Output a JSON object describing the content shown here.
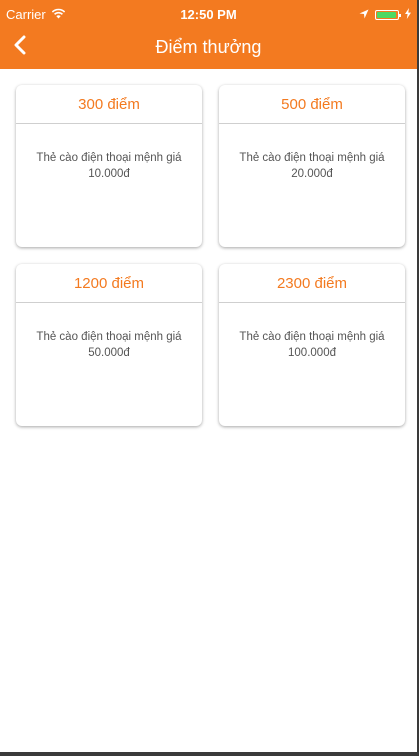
{
  "statusbar": {
    "carrier": "Carrier",
    "time": "12:50 PM",
    "icons": [
      "wifi-icon",
      "location-arrow-icon",
      "battery-icon",
      "charging-bolt-icon"
    ],
    "battery_level_percent": 95
  },
  "navbar": {
    "back_icon": "chevron-left-icon",
    "title": "Điểm thưởng"
  },
  "colors": {
    "accent": "#f37a20",
    "battery": "#4cd964",
    "body_text": "#555555"
  },
  "rewards": [
    {
      "points": "300 điểm",
      "desc_line1": "Thẻ cào điện thoại mệnh giá",
      "desc_line2": "10.000đ"
    },
    {
      "points": "500 điểm",
      "desc_line1": "Thẻ cào điện thoại mệnh giá",
      "desc_line2": "20.000đ"
    },
    {
      "points": "1200 điểm",
      "desc_line1": "Thẻ cào điện thoại mệnh giá",
      "desc_line2": "50.000đ"
    },
    {
      "points": "2300 điểm",
      "desc_line1": "Thẻ cào điện thoại mệnh giá",
      "desc_line2": "100.000đ"
    }
  ]
}
